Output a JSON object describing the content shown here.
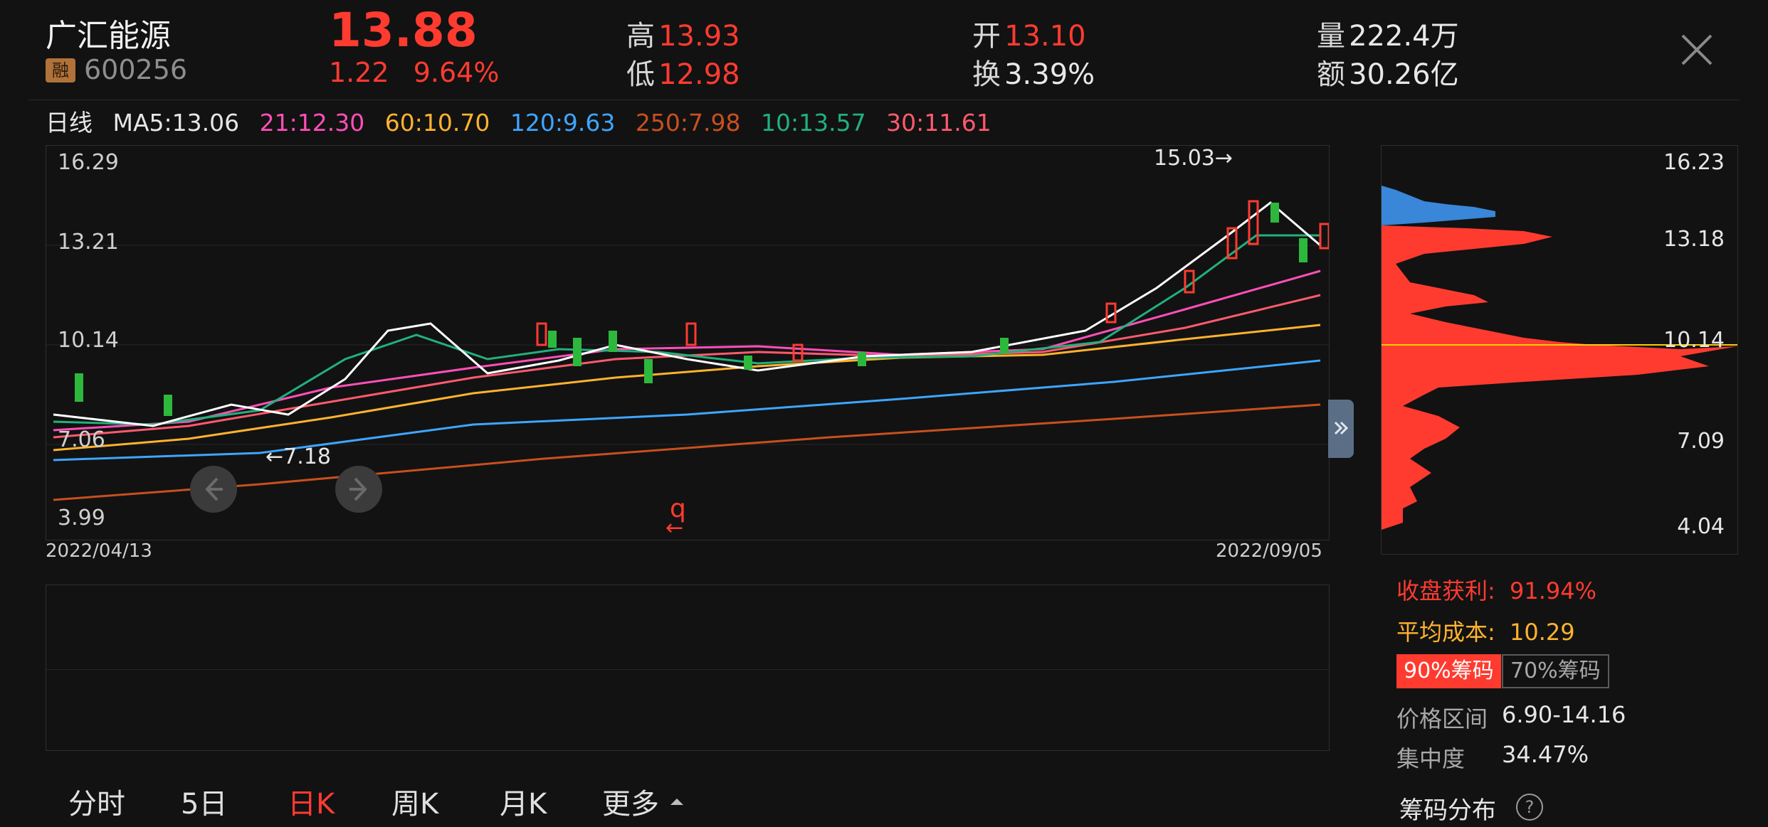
{
  "stock": {
    "name": "广汇能源",
    "tag": "融",
    "code": "600256",
    "price": "13.88",
    "change": "1.22",
    "change_pct": "9.64%"
  },
  "quote": {
    "high_label": "高",
    "high": "13.93",
    "low_label": "低",
    "low": "12.98",
    "open_label": "开",
    "open": "13.10",
    "turnover_label": "换",
    "turnover": "3.39%",
    "volume_label": "量",
    "volume": "222.4万",
    "amount_label": "额",
    "amount": "30.26亿"
  },
  "ma": {
    "period": "日线",
    "ma5": "MA5:13.06",
    "ma21": "21:12.30",
    "ma60": "60:10.70",
    "ma120": "120:9.63",
    "ma250": "250:7.98",
    "ma10": "10:13.57",
    "ma30": "30:11.61",
    "colors": {
      "ma5": "#ffffff",
      "ma21": "#ff4fb8",
      "ma60": "#ffb32e",
      "ma120": "#3ea6ff",
      "ma250": "#c8501e",
      "ma10": "#22b07d",
      "ma30": "#ff5a6e"
    }
  },
  "chart": {
    "y_labels": [
      "16.29",
      "13.21",
      "10.14",
      "7.06",
      "3.99"
    ],
    "x_start": "2022/04/13",
    "x_end": "2022/09/05",
    "high_mark": "15.03→",
    "low_mark": "←7.18",
    "q_mark": "q",
    "q_arrow": "←"
  },
  "chip_dist": {
    "y_labels": [
      "16.23",
      "13.18",
      "10.14",
      "7.09",
      "4.04"
    ],
    "profit_label": "收盘获利:",
    "profit": "91.94%",
    "avg_cost_label": "平均成本:",
    "avg_cost": "10.29",
    "btn_90": "90%筹码",
    "btn_70": "70%筹码",
    "range_label": "价格区间",
    "range": "6.90-14.16",
    "conc_label": "集中度",
    "conc": "34.47%",
    "title": "筹码分布",
    "help": "?"
  },
  "tabs": [
    "分时",
    "5日",
    "日K",
    "周K",
    "月K",
    "更多"
  ],
  "active_tab": "日K"
}
